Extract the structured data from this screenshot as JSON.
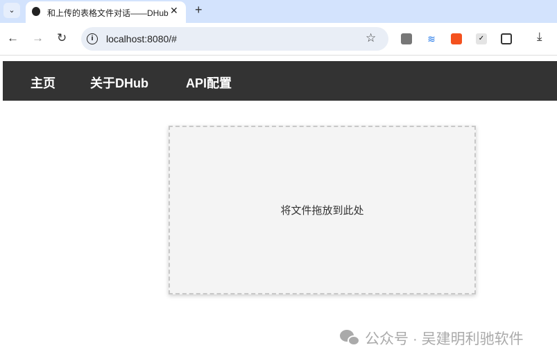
{
  "browser": {
    "tab_title": "和上传的表格文件对话——DHub",
    "url": "localhost:8080/#"
  },
  "nav": {
    "items": [
      "主页",
      "关于DHub",
      "API配置"
    ]
  },
  "dropzone": {
    "text": "将文件拖放到此处"
  },
  "watermark": {
    "text": "公众号 · 吴建明利驰软件"
  }
}
